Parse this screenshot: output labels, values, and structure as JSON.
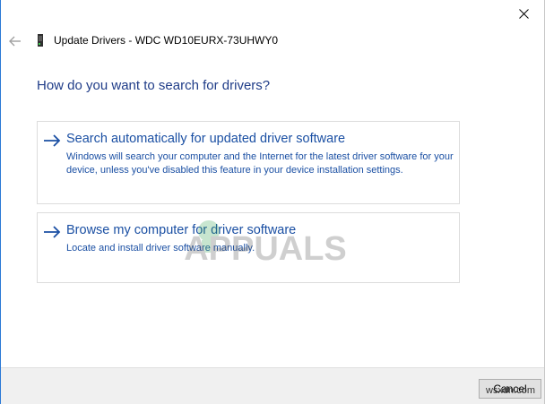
{
  "window": {
    "title": "Update Drivers - WDC WD10EURX-73UHWY0"
  },
  "icons": {
    "close": "close-icon",
    "back": "back-arrow-icon",
    "device": "hard-drive-device-icon",
    "option_arrow": "arrow-right-icon"
  },
  "main": {
    "heading": "How do you want to search for drivers?",
    "options": [
      {
        "title": "Search automatically for updated driver software",
        "description": "Windows will search your computer and the Internet for the latest driver software for your device, unless you've disabled this feature in your device installation settings."
      },
      {
        "title": "Browse my computer for driver software",
        "description": "Locate and install driver software manually."
      }
    ]
  },
  "footer": {
    "cancel_label": "Cancel"
  },
  "watermark": {
    "logo_text": "APPUALS",
    "site_text": "wsxdn.com"
  },
  "colors": {
    "heading": "#1f3c88",
    "link": "#1a4fa3",
    "accent_border": "#2b79d6",
    "footer_bg": "#f0f0f0"
  }
}
